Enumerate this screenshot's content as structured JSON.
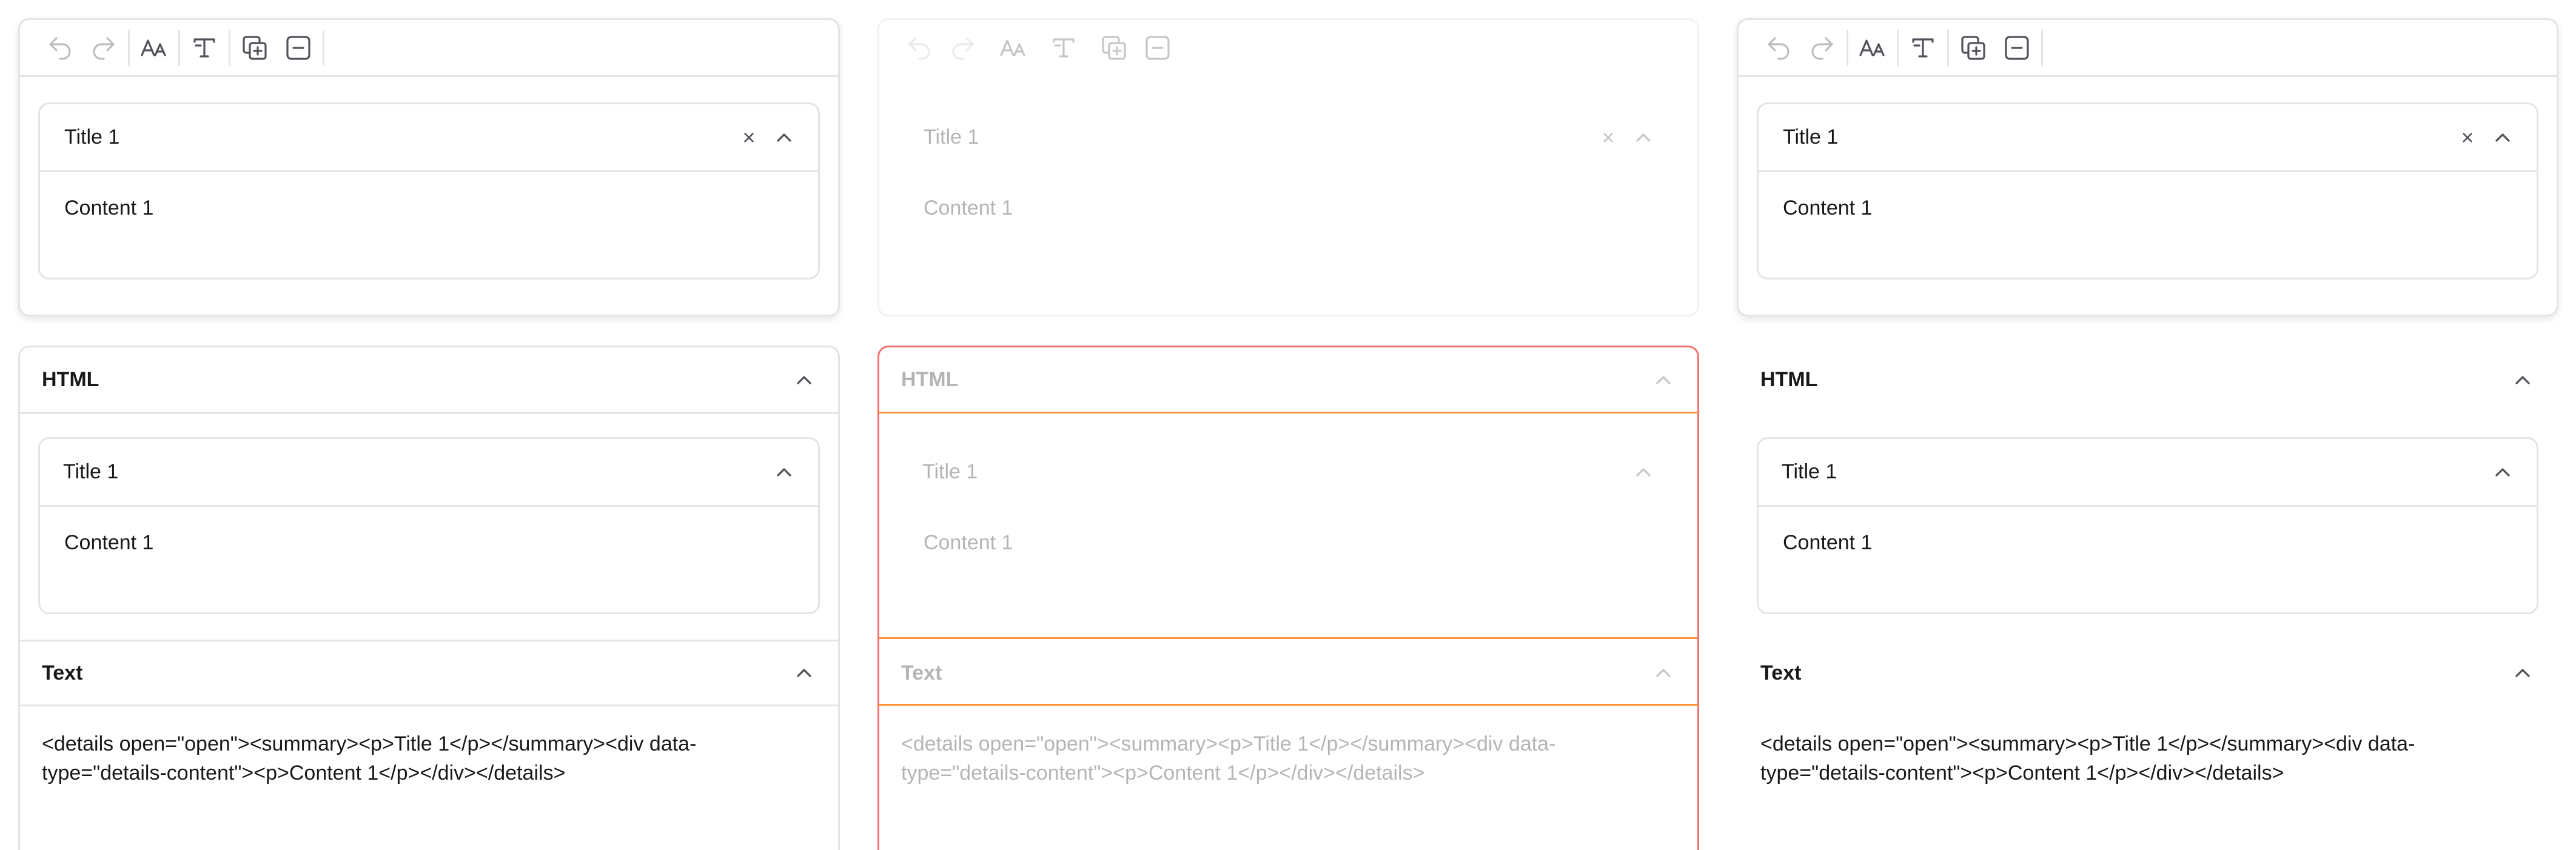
{
  "columns": [
    {
      "editor": {
        "details_title": "Title 1",
        "details_content": "Content 1"
      },
      "html_section": {
        "label": "HTML",
        "details_title": "Title 1",
        "details_content": "Content 1"
      },
      "text_section": {
        "label": "Text",
        "code": "<details open=\"open\"><summary><p>Title 1</p></summary><div data-type=\"details-content\"><p>Content 1</p></div></details>"
      }
    },
    {
      "editor": {
        "details_title": "Title 1",
        "details_content": "Content 1"
      },
      "html_section": {
        "label": "HTML",
        "details_title": "Title 1",
        "details_content": "Content 1"
      },
      "text_section": {
        "label": "Text",
        "code": "<details open=\"open\"><summary><p>Title 1</p></summary><div data-type=\"details-content\"><p>Content 1</p></div></details>"
      }
    },
    {
      "editor": {
        "details_title": "Title 1",
        "details_content": "Content 1"
      },
      "html_section": {
        "label": "HTML",
        "details_title": "Title 1",
        "details_content": "Content 1"
      },
      "text_section": {
        "label": "Text",
        "code": "<details open=\"open\"><summary><p>Title 1</p></summary><div data-type=\"details-content\"><p>Content 1</p></div></details>"
      }
    }
  ],
  "toolbar_icons": [
    "undo-icon",
    "redo-icon",
    "font-size-icon",
    "text-style-icon",
    "duplicate-icon",
    "remove-icon"
  ],
  "colors": {
    "border": "#e4e4e7",
    "focus_red": "#f87171",
    "focus_orange": "#fb923c",
    "text": "#18181b"
  }
}
